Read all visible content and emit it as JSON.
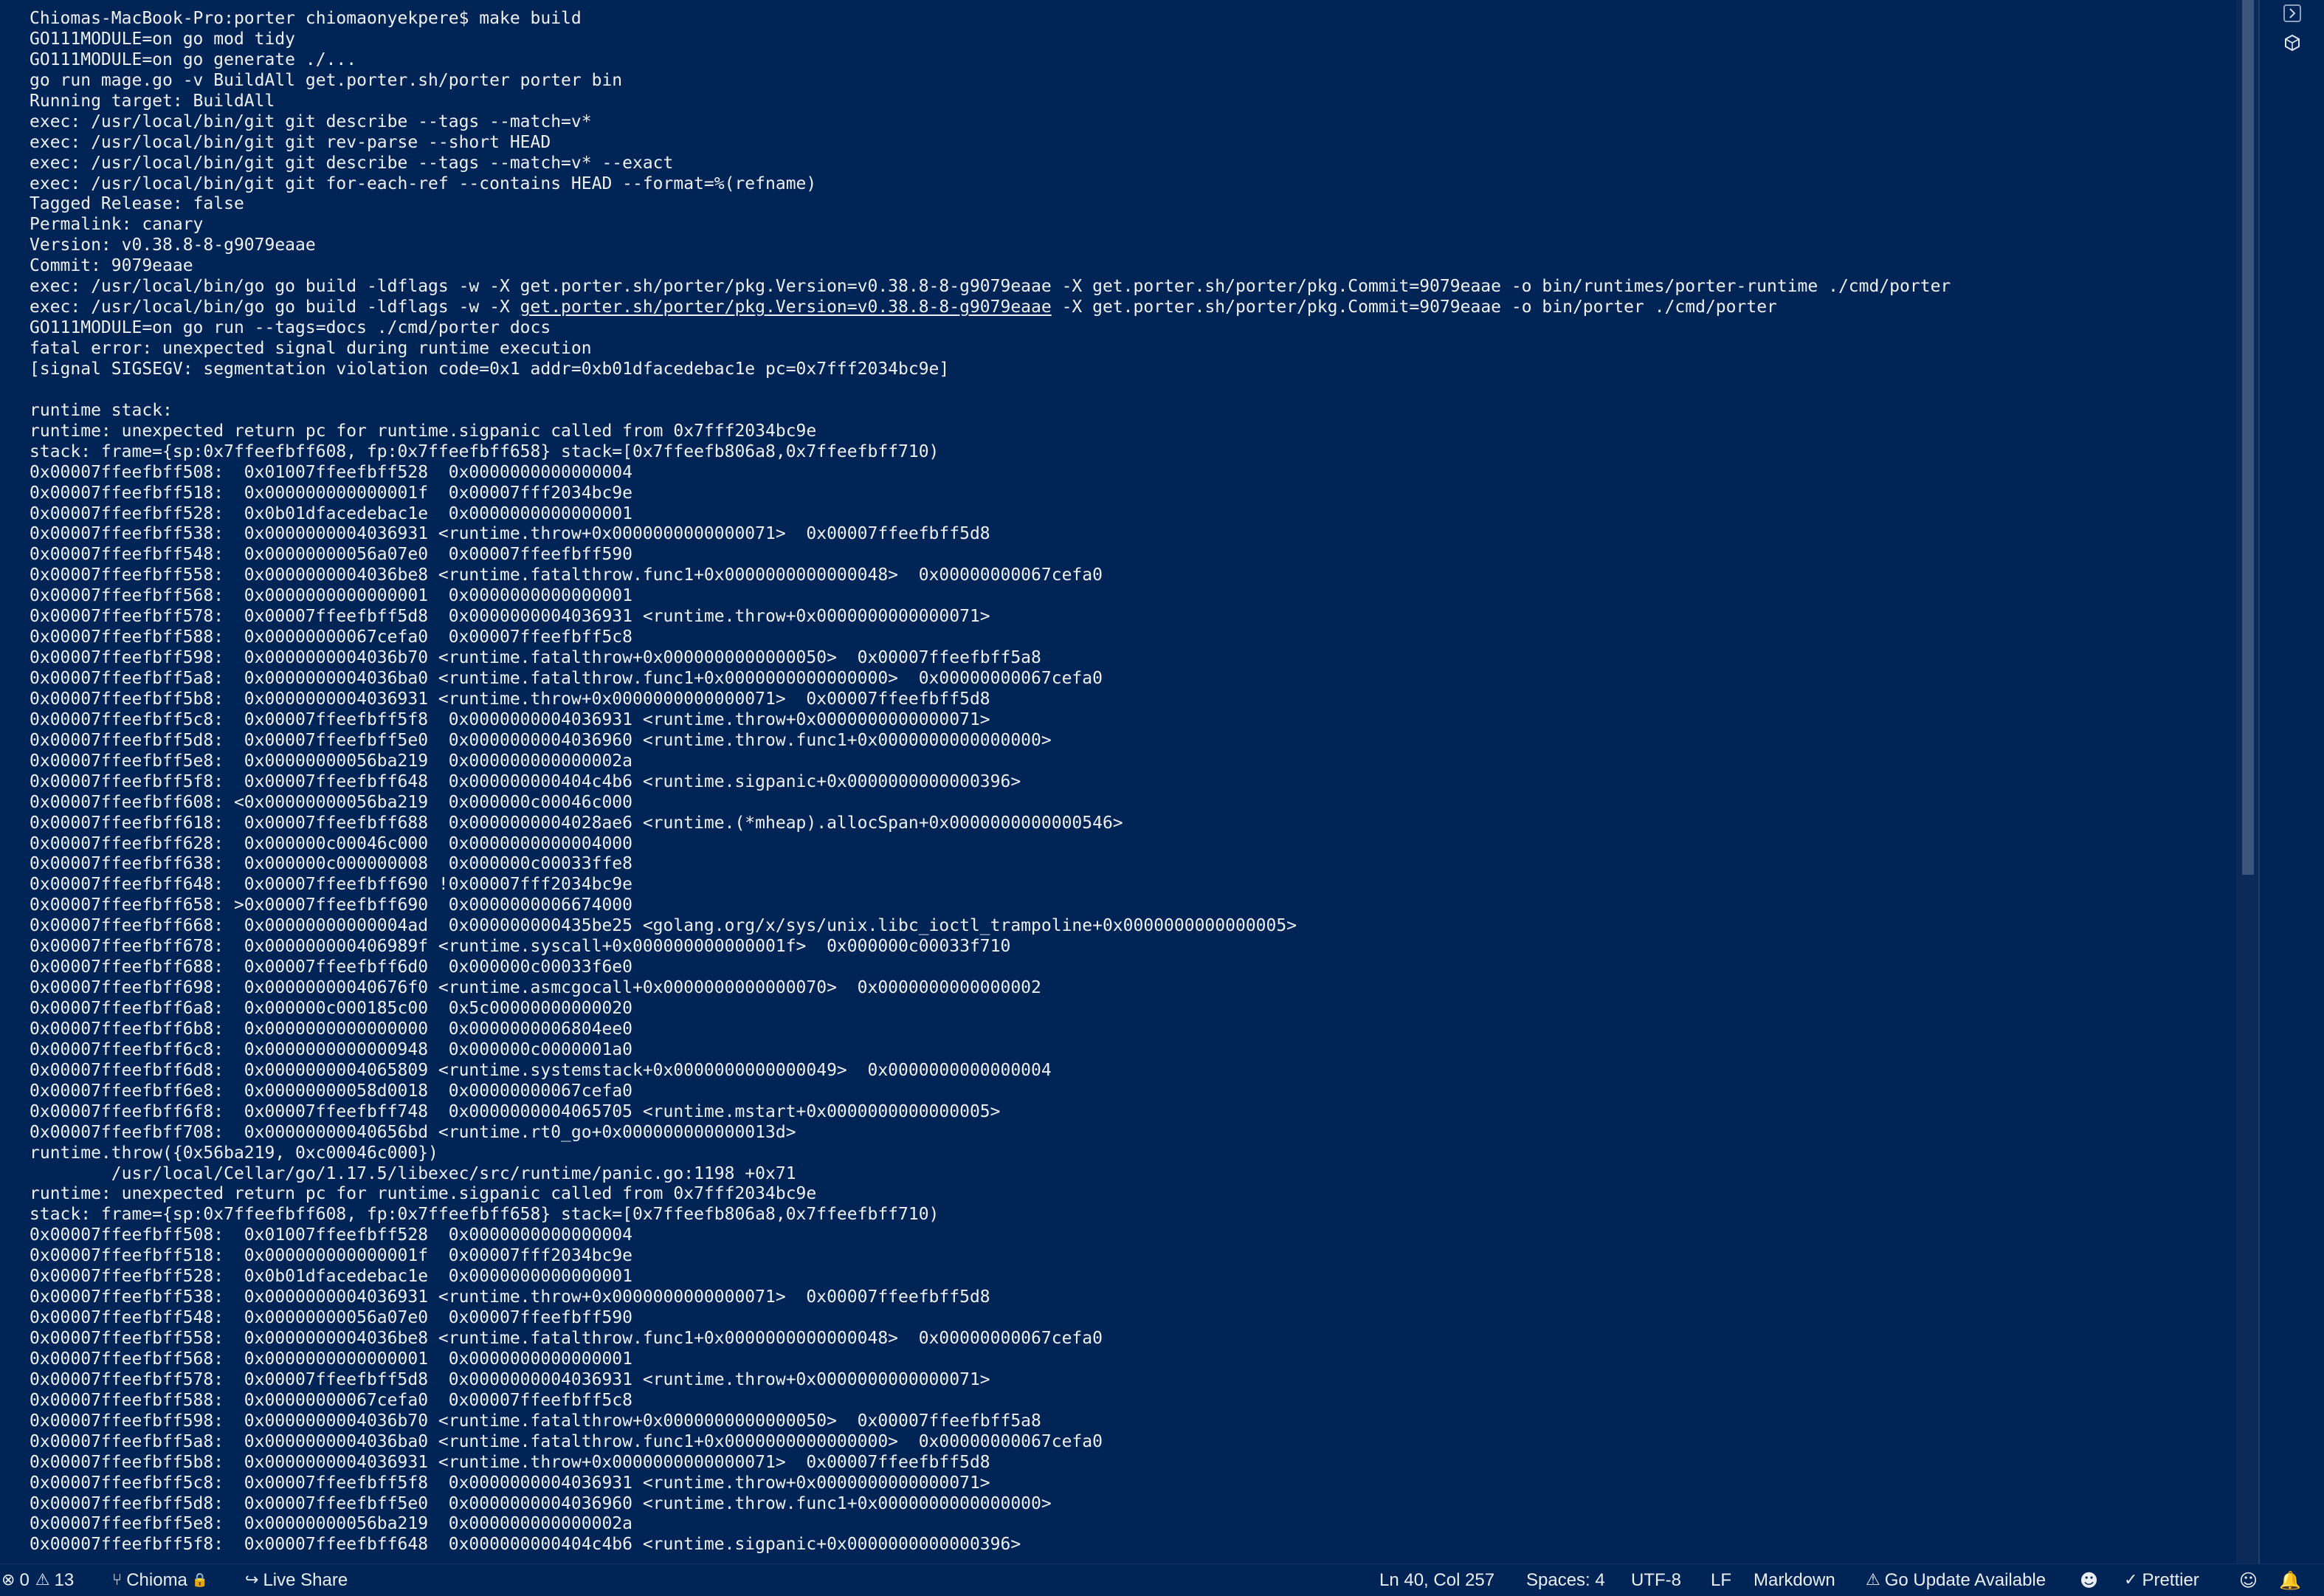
{
  "terminal": {
    "lines": [
      "Chiomas-MacBook-Pro:porter chiomaonyekpere$ make build",
      "GO111MODULE=on go mod tidy",
      "GO111MODULE=on go generate ./...",
      "go run mage.go -v BuildAll get.porter.sh/porter porter bin",
      "Running target: BuildAll",
      "exec: /usr/local/bin/git git describe --tags --match=v*",
      "exec: /usr/local/bin/git git rev-parse --short HEAD",
      "exec: /usr/local/bin/git git describe --tags --match=v* --exact",
      "exec: /usr/local/bin/git git for-each-ref --contains HEAD --format=%(refname)",
      "Tagged Release: false",
      "Permalink: canary",
      "Version: v0.38.8-8-g9079eaae",
      "Commit: 9079eaae",
      "exec: /usr/local/bin/go go build -ldflags -w -X get.porter.sh/porter/pkg.Version=v0.38.8-8-g9079eaae -X get.porter.sh/porter/pkg.Commit=9079eaae -o bin/runtimes/porter-runtime ./cmd/porter",
      "exec: /usr/local/bin/go go build -ldflags -w -X get.porter.sh/porter/pkg.Version=v0.38.8-8-g9079eaae -X get.porter.sh/porter/pkg.Commit=9079eaae -o bin/porter ./cmd/porter",
      "GO111MODULE=on go run --tags=docs ./cmd/porter docs",
      "fatal error: unexpected signal during runtime execution",
      "[signal SIGSEGV: segmentation violation code=0x1 addr=0xb01dfacedebac1e pc=0x7fff2034bc9e]",
      "",
      "runtime stack:",
      "runtime: unexpected return pc for runtime.sigpanic called from 0x7fff2034bc9e",
      "stack: frame={sp:0x7ffeefbff608, fp:0x7ffeefbff658} stack=[0x7ffeefb806a8,0x7ffeefbff710)",
      "0x00007ffeefbff508:  0x01007ffeefbff528  0x0000000000000004",
      "0x00007ffeefbff518:  0x000000000000001f  0x00007fff2034bc9e",
      "0x00007ffeefbff528:  0x0b01dfacedebac1e  0x0000000000000001",
      "0x00007ffeefbff538:  0x0000000004036931 <runtime.throw+0x0000000000000071>  0x00007ffeefbff5d8",
      "0x00007ffeefbff548:  0x00000000056a07e0  0x00007ffeefbff590",
      "0x00007ffeefbff558:  0x0000000004036be8 <runtime.fatalthrow.func1+0x0000000000000048>  0x00000000067cefa0",
      "0x00007ffeefbff568:  0x0000000000000001  0x0000000000000001",
      "0x00007ffeefbff578:  0x00007ffeefbff5d8  0x0000000004036931 <runtime.throw+0x0000000000000071>",
      "0x00007ffeefbff588:  0x00000000067cefa0  0x00007ffeefbff5c8",
      "0x00007ffeefbff598:  0x0000000004036b70 <runtime.fatalthrow+0x0000000000000050>  0x00007ffeefbff5a8",
      "0x00007ffeefbff5a8:  0x0000000004036ba0 <runtime.fatalthrow.func1+0x0000000000000000>  0x00000000067cefa0",
      "0x00007ffeefbff5b8:  0x0000000004036931 <runtime.throw+0x0000000000000071>  0x00007ffeefbff5d8",
      "0x00007ffeefbff5c8:  0x00007ffeefbff5f8  0x0000000004036931 <runtime.throw+0x0000000000000071>",
      "0x00007ffeefbff5d8:  0x00007ffeefbff5e0  0x0000000004036960 <runtime.throw.func1+0x0000000000000000>",
      "0x00007ffeefbff5e8:  0x00000000056ba219  0x000000000000002a",
      "0x00007ffeefbff5f8:  0x00007ffeefbff648  0x000000000404c4b6 <runtime.sigpanic+0x0000000000000396>",
      "0x00007ffeefbff608: <0x00000000056ba219  0x000000c00046c000",
      "0x00007ffeefbff618:  0x00007ffeefbff688  0x0000000004028ae6 <runtime.(*mheap).allocSpan+0x0000000000000546>",
      "0x00007ffeefbff628:  0x000000c00046c000  0x0000000000004000",
      "0x00007ffeefbff638:  0x000000c000000008  0x000000c00033ffe8",
      "0x00007ffeefbff648:  0x00007ffeefbff690 !0x00007fff2034bc9e",
      "0x00007ffeefbff658: >0x00007ffeefbff690  0x0000000006674000",
      "0x00007ffeefbff668:  0x00000000000004ad  0x000000000435be25 <golang.org/x/sys/unix.libc_ioctl_trampoline+0x0000000000000005>",
      "0x00007ffeefbff678:  0x000000000406989f <runtime.syscall+0x000000000000001f>  0x000000c00033f710",
      "0x00007ffeefbff688:  0x00007ffeefbff6d0  0x000000c00033f6e0",
      "0x00007ffeefbff698:  0x00000000040676f0 <runtime.asmcgocall+0x0000000000000070>  0x0000000000000002",
      "0x00007ffeefbff6a8:  0x000000c000185c00  0x5c00000000000020",
      "0x00007ffeefbff6b8:  0x0000000000000000  0x0000000006804ee0",
      "0x00007ffeefbff6c8:  0x0000000000000948  0x000000c0000001a0",
      "0x00007ffeefbff6d8:  0x0000000004065809 <runtime.systemstack+0x0000000000000049>  0x0000000000000004",
      "0x00007ffeefbff6e8:  0x00000000058d0018  0x00000000067cefa0",
      "0x00007ffeefbff6f8:  0x00007ffeefbff748  0x0000000004065705 <runtime.mstart+0x0000000000000005>",
      "0x00007ffeefbff708:  0x00000000040656bd <runtime.rt0_go+0x000000000000013d>",
      "runtime.throw({0x56ba219, 0xc00046c000})",
      "        /usr/local/Cellar/go/1.17.5/libexec/src/runtime/panic.go:1198 +0x71",
      "runtime: unexpected return pc for runtime.sigpanic called from 0x7fff2034bc9e",
      "stack: frame={sp:0x7ffeefbff608, fp:0x7ffeefbff658} stack=[0x7ffeefb806a8,0x7ffeefbff710)",
      "0x00007ffeefbff508:  0x01007ffeefbff528  0x0000000000000004",
      "0x00007ffeefbff518:  0x000000000000001f  0x00007fff2034bc9e",
      "0x00007ffeefbff528:  0x0b01dfacedebac1e  0x0000000000000001",
      "0x00007ffeefbff538:  0x0000000004036931 <runtime.throw+0x0000000000000071>  0x00007ffeefbff5d8",
      "0x00007ffeefbff548:  0x00000000056a07e0  0x00007ffeefbff590",
      "0x00007ffeefbff558:  0x0000000004036be8 <runtime.fatalthrow.func1+0x0000000000000048>  0x00000000067cefa0",
      "0x00007ffeefbff568:  0x0000000000000001  0x0000000000000001",
      "0x00007ffeefbff578:  0x00007ffeefbff5d8  0x0000000004036931 <runtime.throw+0x0000000000000071>",
      "0x00007ffeefbff588:  0x00000000067cefa0  0x00007ffeefbff5c8",
      "0x00007ffeefbff598:  0x0000000004036b70 <runtime.fatalthrow+0x0000000000000050>  0x00007ffeefbff5a8",
      "0x00007ffeefbff5a8:  0x0000000004036ba0 <runtime.fatalthrow.func1+0x0000000000000000>  0x00000000067cefa0",
      "0x00007ffeefbff5b8:  0x0000000004036931 <runtime.throw+0x0000000000000071>  0x00007ffeefbff5d8",
      "0x00007ffeefbff5c8:  0x00007ffeefbff5f8  0x0000000004036931 <runtime.throw+0x0000000000000071>",
      "0x00007ffeefbff5d8:  0x00007ffeefbff5e0  0x0000000004036960 <runtime.throw.func1+0x0000000000000000>",
      "0x00007ffeefbff5e8:  0x00000000056ba219  0x000000000000002a",
      "0x00007ffeefbff5f8:  0x00007ffeefbff648  0x000000000404c4b6 <runtime.sigpanic+0x0000000000000396>"
    ],
    "link_line": {
      "before": "exec: /usr/local/bin/go go build -ldflags -w -X ",
      "link": "get.porter.sh/porter/pkg.Version=v0.38.8-8-g9079eaae",
      "after": " -X get.porter.sh/porter/pkg.Commit=9079eaae -o bin/porter ./cmd/porter"
    }
  },
  "side_panel": {
    "maximize_icon": "chevron-right-icon",
    "extension_icon": "cube-icon"
  },
  "status_bar": {
    "errors": "0",
    "warnings": "13",
    "branch": "Chioma",
    "branch_icon": "git-branch-icon",
    "lock_icon": "lock-icon",
    "live_share": "Live Share",
    "cursor_position": "Ln 40, Col 257",
    "indentation": "Spaces: 4",
    "encoding": "UTF-8",
    "line_ending": "LF",
    "language": "Markdown",
    "go_update": "Go Update Available",
    "prettier": "Prettier"
  },
  "colors": {
    "background": "#012456",
    "text": "#eef0f4",
    "scrollbar": "#3a5579"
  }
}
